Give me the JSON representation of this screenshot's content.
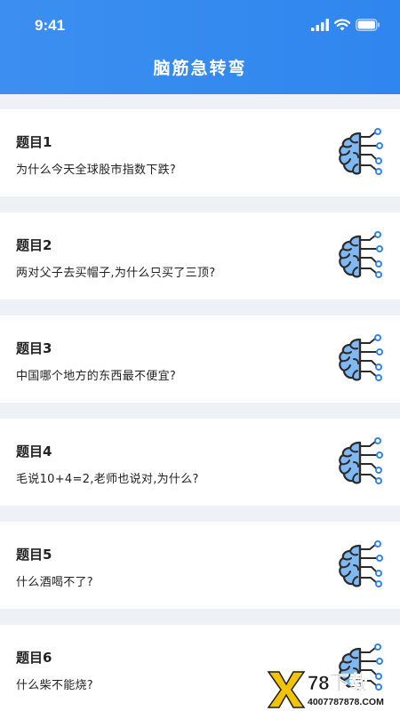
{
  "status_bar": {
    "time": "9:41",
    "icons": [
      "signal-icon",
      "wifi-icon",
      "battery-icon"
    ]
  },
  "header": {
    "title": "脑筋急转弯"
  },
  "colors": {
    "header_blue": "#3c8ff0",
    "icon_blue": "#7fb8f3",
    "icon_line": "#2b2b2b",
    "node_blue": "#2f86ee",
    "background": "#eef1f6"
  },
  "questions": [
    {
      "title": "题目1",
      "text": "为什么今天全球股市指数下跌?"
    },
    {
      "title": "题目2",
      "text": "两对父子去买帽子,为什么只买了三顶?"
    },
    {
      "title": "题目3",
      "text": "中国哪个地方的东西最不便宜?"
    },
    {
      "title": "题目4",
      "text": "毛说10+4=2,老师也说对,为什么?"
    },
    {
      "title": "题目5",
      "text": "什么酒喝不了?"
    },
    {
      "title": "题目6",
      "text": "什么柴不能烧?"
    }
  ],
  "watermark": {
    "logo": "78下载",
    "domain": "4007787878.COM"
  }
}
